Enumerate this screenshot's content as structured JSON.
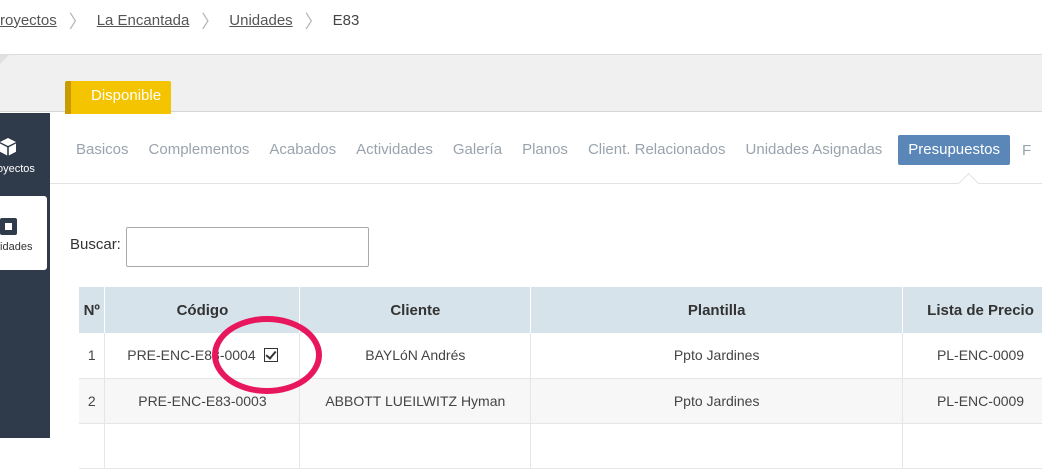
{
  "breadcrumb": {
    "items": [
      "Proyectos",
      "La Encantada",
      "Unidades"
    ],
    "current": "E83",
    "separator": "〉"
  },
  "status": {
    "label": "Disponible",
    "color": "#f5c400"
  },
  "sidebar": {
    "items": [
      {
        "label": "Proyectos",
        "icon": "cube-icon"
      },
      {
        "label": "Unidades",
        "icon": "unit-square-icon",
        "active": true
      }
    ]
  },
  "tabs": {
    "items": [
      "Basicos",
      "Complementos",
      "Acabados",
      "Actividades",
      "Galería",
      "Planos",
      "Client. Relacionados",
      "Unidades Asignadas"
    ],
    "active": "Presupuestos",
    "overflow": "F"
  },
  "search": {
    "label": "Buscar:",
    "value": ""
  },
  "table": {
    "headers": [
      "Nº",
      "Código",
      "Cliente",
      "Plantilla",
      "Lista de Precio"
    ],
    "rows": [
      {
        "n": "1",
        "code": "PRE-ENC-E83-0004",
        "client": "BAYLóN Andrés",
        "template": "Ppto Jardines",
        "price_list": "PL-ENC-0009",
        "checked": true
      },
      {
        "n": "2",
        "code": "PRE-ENC-E83-0003",
        "client": "ABBOTT LUEILWITZ Hyman",
        "template": "Ppto Jardines",
        "price_list": "PL-ENC-0009"
      }
    ]
  },
  "colors": {
    "accent": "#5b87b8",
    "sidebar": "#2f3a4a",
    "annotation": "#e8175d",
    "header_bg": "#d6e3ea"
  }
}
